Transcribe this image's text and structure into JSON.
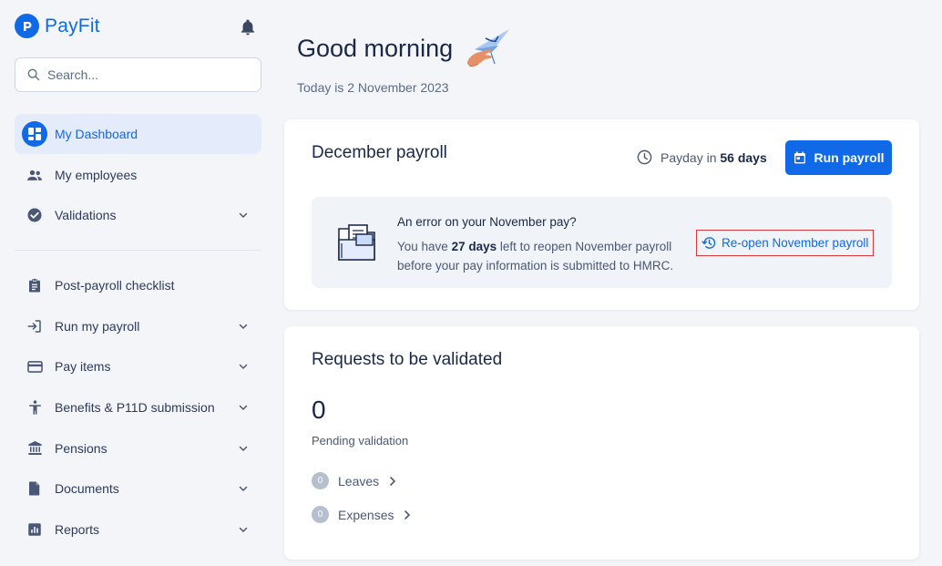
{
  "brand": {
    "name": "PayFit"
  },
  "search": {
    "placeholder": "Search..."
  },
  "nav": {
    "primary": [
      {
        "label": "My Dashboard",
        "icon": "dashboard-icon",
        "active": true
      },
      {
        "label": "My employees",
        "icon": "people-icon"
      },
      {
        "label": "Validations",
        "icon": "check-circle-icon",
        "expandable": true
      }
    ],
    "secondary": [
      {
        "label": "Post-payroll checklist",
        "icon": "clipboard-icon"
      },
      {
        "label": "Run my payroll",
        "icon": "login-arrow-icon",
        "expandable": true
      },
      {
        "label": "Pay items",
        "icon": "credit-card-icon",
        "expandable": true
      },
      {
        "label": "Benefits & P11D submission",
        "icon": "accessibility-icon",
        "expandable": true
      },
      {
        "label": "Pensions",
        "icon": "bank-icon",
        "expandable": true
      },
      {
        "label": "Documents",
        "icon": "document-icon",
        "expandable": true
      },
      {
        "label": "Reports",
        "icon": "bar-chart-icon",
        "expandable": true
      }
    ]
  },
  "header": {
    "greeting": "Good morning",
    "today": "Today is 2 November 2023"
  },
  "payroll_card": {
    "title": "December payroll",
    "payday_prefix": "Payday in",
    "payday_value": "56 days",
    "run_button": "Run payroll",
    "notice": {
      "heading": "An error on your November pay?",
      "body_prefix": "You have ",
      "body_days": "27 days",
      "body_suffix": " left to reopen November payroll before your pay information is submitted to HMRC.",
      "reopen_link": "Re-open November payroll"
    }
  },
  "requests_card": {
    "title": "Requests to be validated",
    "count": "0",
    "pending_label": "Pending validation",
    "rows": [
      {
        "count": "0",
        "label": "Leaves"
      },
      {
        "count": "0",
        "label": "Expenses"
      }
    ]
  },
  "colors": {
    "accent": "#1069e6",
    "highlight_border": "#d93b3b"
  }
}
